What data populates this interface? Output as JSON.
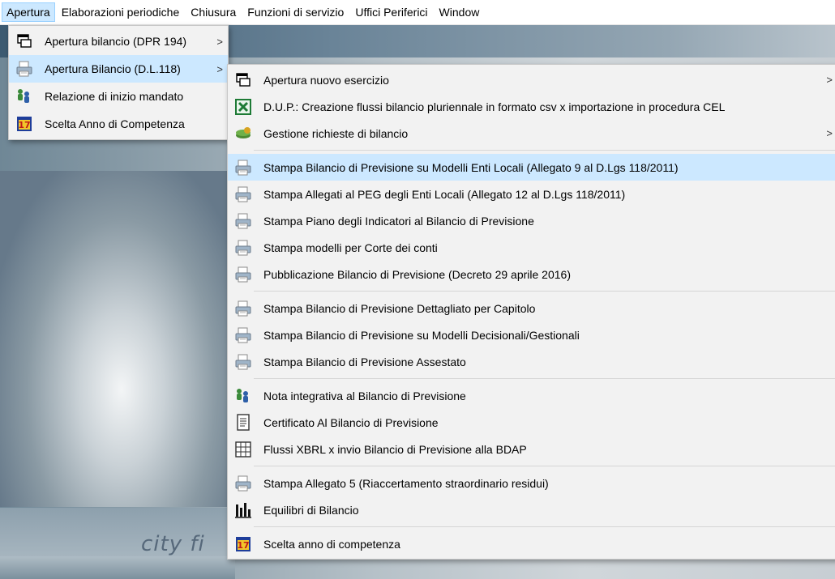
{
  "menubar": {
    "items": [
      "Apertura",
      "Elaborazioni periodiche",
      "Chiusura",
      "Funzioni di servizio",
      "Uffici Periferici",
      "Window"
    ]
  },
  "background": {
    "brand_text": "city fi"
  },
  "menu1": {
    "items": [
      {
        "label": "Apertura bilancio (DPR 194)",
        "icon": "window-icon",
        "submenu": true
      },
      {
        "label": "Apertura Bilancio (D.L.118)",
        "icon": "printer-icon",
        "submenu": true,
        "highlighted": true
      },
      {
        "label": "Relazione di inizio mandato",
        "icon": "people-icon",
        "submenu": false
      },
      {
        "label": "Scelta Anno di Competenza",
        "icon": "calendar-icon",
        "submenu": false
      }
    ]
  },
  "menu2": {
    "items": [
      {
        "label": "Apertura nuovo esercizio",
        "icon": "window-icon",
        "submenu": true
      },
      {
        "label": "D.U.P.: Creazione flussi bilancio pluriennale in formato csv x importazione in procedura CEL",
        "icon": "excel-icon"
      },
      {
        "label": "Gestione richieste di bilancio",
        "icon": "money-icon",
        "submenu": true
      },
      {
        "label": "Stampa Bilancio di Previsione su Modelli Enti Locali (Allegato 9 al D.Lgs 118/2011)",
        "icon": "printer-icon",
        "highlighted": true
      },
      {
        "label": "Stampa Allegati al PEG degli Enti Locali (Allegato 12 al D.Lgs 118/2011)",
        "icon": "printer-icon"
      },
      {
        "label": "Stampa Piano degli Indicatori al Bilancio di Previsione",
        "icon": "printer-icon"
      },
      {
        "label": "Stampa modelli per Corte dei conti",
        "icon": "printer-icon"
      },
      {
        "label": "Pubblicazione Bilancio di Previsione (Decreto 29 aprile 2016)",
        "icon": "printer-icon"
      },
      {
        "label": "Stampa Bilancio di Previsione Dettagliato per Capitolo",
        "icon": "printer-icon"
      },
      {
        "label": "Stampa Bilancio di Previsione su Modelli Decisionali/Gestionali",
        "icon": "printer-icon"
      },
      {
        "label": "Stampa Bilancio di Previsione Assestato",
        "icon": "printer-icon"
      },
      {
        "label": "Nota integrativa al Bilancio di Previsione",
        "icon": "people-icon"
      },
      {
        "label": "Certificato Al Bilancio di Previsione",
        "icon": "document-icon"
      },
      {
        "label": "Flussi XBRL x invio Bilancio di Previsione alla BDAP",
        "icon": "grid-icon"
      },
      {
        "label": "Stampa Allegato 5 (Riaccertamento straordinario residui)",
        "icon": "printer-icon"
      },
      {
        "label": "Equilibri di Bilancio",
        "icon": "bar-chart-icon"
      },
      {
        "label": "Scelta anno di competenza",
        "icon": "calendar-icon"
      }
    ],
    "submenu_arrow": ">"
  },
  "colors": {
    "highlight": "#cce8ff",
    "menu_bg": "#f2f2f2"
  }
}
